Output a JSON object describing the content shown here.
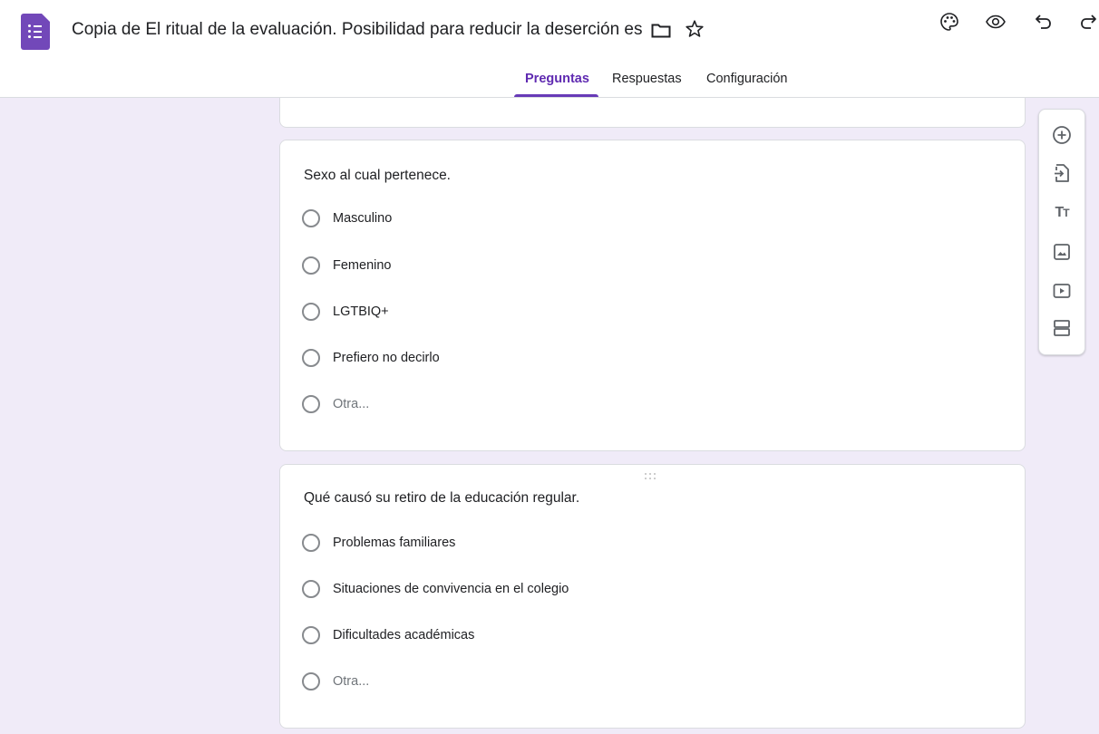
{
  "header": {
    "doc_title": "Copia de El ritual de la evaluación. Posibilidad para reducir la deserción es",
    "icons": [
      "forms-logo-icon",
      "folder-icon",
      "star-icon",
      "palette-icon",
      "preview-eye-icon",
      "undo-icon",
      "redo-icon"
    ]
  },
  "tabs": [
    {
      "label": "Preguntas",
      "active": true
    },
    {
      "label": "Respuestas",
      "active": false
    },
    {
      "label": "Configuración",
      "active": false
    }
  ],
  "questions": [
    {
      "title": "Sexo al cual pertenece.",
      "options": [
        "Masculino",
        "Femenino",
        "LGTBIQ+",
        "Prefiero no decirlo"
      ],
      "other": "Otra..."
    },
    {
      "title": "Qué causó su retiro de la educación regular.",
      "options": [
        "Problemas familiares",
        "Situaciones de convivencia en el colegio",
        "Dificultades académicas"
      ],
      "other": "Otra..."
    }
  ],
  "toolbar": {
    "tools": [
      "add-question-icon",
      "import-questions-icon",
      "add-title-icon",
      "add-image-icon",
      "add-video-icon",
      "add-section-icon"
    ],
    "title_glyph": "T"
  },
  "colors": {
    "accent": "#673ab7",
    "canvas_bg": "#f0ebf8",
    "logo": "#7248b9"
  }
}
